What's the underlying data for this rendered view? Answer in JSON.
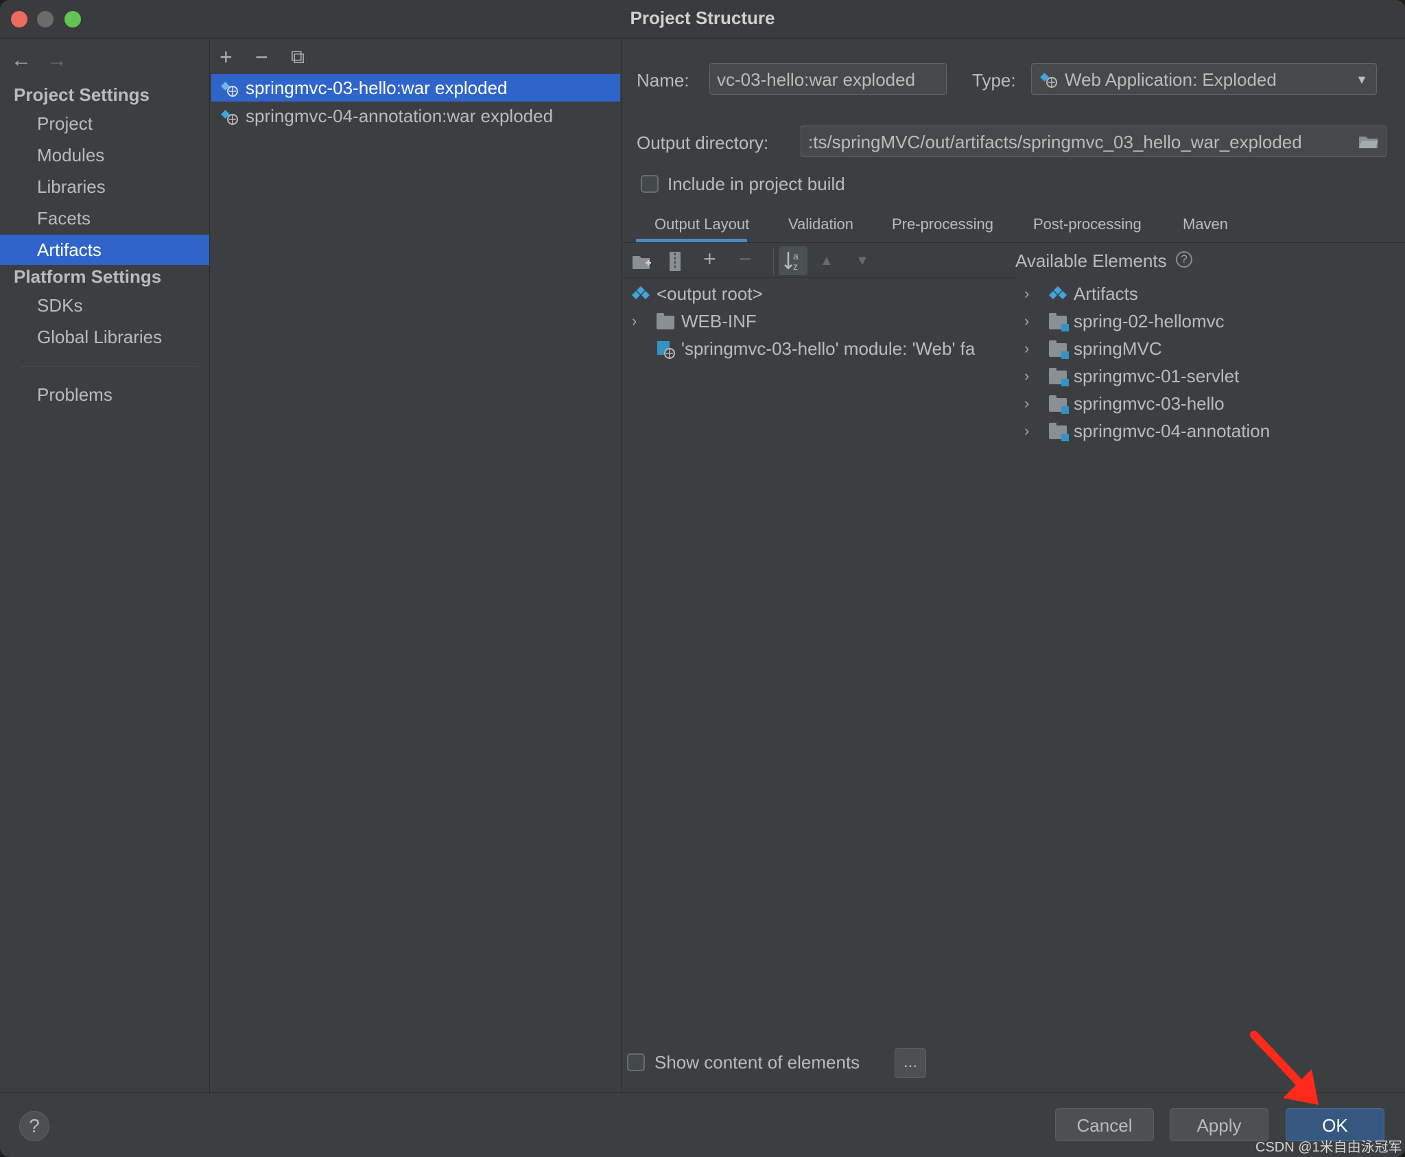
{
  "window": {
    "title": "Project Structure"
  },
  "nav": {
    "back": "←",
    "forward": "→"
  },
  "sidebar": {
    "project_settings_header": "Project Settings",
    "project_items": [
      "Project",
      "Modules",
      "Libraries",
      "Facets",
      "Artifacts"
    ],
    "selected": "Artifacts",
    "platform_settings_header": "Platform Settings",
    "platform_items": [
      "SDKs",
      "Global Libraries"
    ],
    "problems": "Problems"
  },
  "artifact_list": {
    "toolbar": {
      "add": "+",
      "remove": "−",
      "copy": "⧉"
    },
    "items": [
      {
        "label": "springmvc-03-hello:war exploded",
        "selected": true
      },
      {
        "label": "springmvc-04-annotation:war exploded",
        "selected": false
      }
    ]
  },
  "details": {
    "name_label": "Name:",
    "name_value": "vc-03-hello:war exploded",
    "type_label": "Type:",
    "type_value": "Web Application: Exploded",
    "output_dir_label": "Output directory:",
    "output_dir_value": ":ts/springMVC/out/artifacts/springmvc_03_hello_war_exploded",
    "include_build_label": "Include in project build",
    "include_build_checked": false,
    "tabs": [
      "Output Layout",
      "Validation",
      "Pre-processing",
      "Post-processing",
      "Maven"
    ],
    "active_tab": "Output Layout",
    "layout_toolbar": {
      "add": "+",
      "remove": "−",
      "up": "▲",
      "down": "▼"
    },
    "output_tree": [
      {
        "label": "<output root>"
      },
      {
        "label": "WEB-INF"
      },
      {
        "label": "'springmvc-03-hello' module: 'Web' fa"
      }
    ],
    "available_elements_label": "Available Elements",
    "available_help": "?",
    "available_tree": [
      {
        "label": "Artifacts"
      },
      {
        "label": "spring-02-hellomvc"
      },
      {
        "label": "springMVC"
      },
      {
        "label": "springmvc-01-servlet"
      },
      {
        "label": "springmvc-03-hello"
      },
      {
        "label": "springmvc-04-annotation"
      }
    ],
    "show_content_label": "Show content of elements",
    "show_content_checked": false,
    "ellipsis_button": "..."
  },
  "buttons": {
    "help": "?",
    "cancel": "Cancel",
    "apply": "Apply",
    "ok": "OK"
  },
  "watermark": "CSDN @1米自由泳冠军",
  "colors": {
    "selection": "#2f65ca",
    "ok_button": "#365880",
    "annotation_arrow": "#ff2a1a"
  }
}
